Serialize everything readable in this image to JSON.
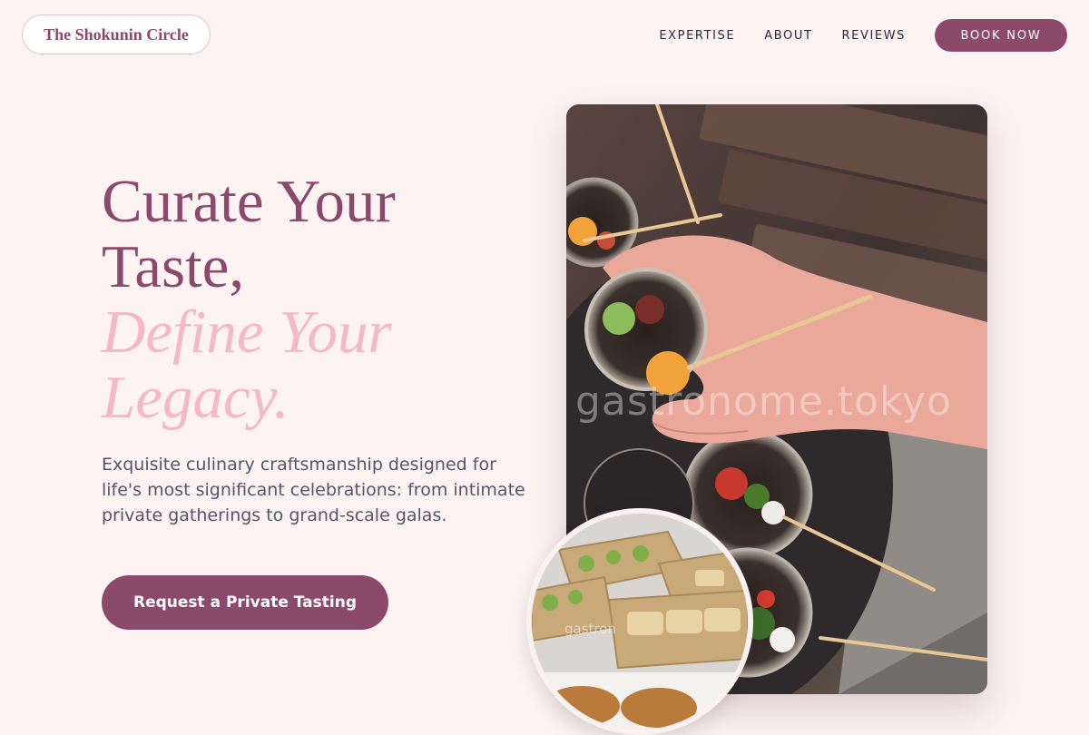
{
  "header": {
    "logo_text": "The Shokunin Circle",
    "nav": [
      "EXPERTISE",
      "ABOUT",
      "REVIEWS"
    ],
    "book_label": "BOOK NOW"
  },
  "hero": {
    "title_line1": "Curate Your",
    "title_line2": "Taste,",
    "title_accent1": "Define Your",
    "title_accent2": "Legacy.",
    "description": "Exquisite culinary craftsmanship designed for life's most significant celebrations: from intimate private gatherings to grand-scale galas.",
    "cta_label": "Request a Private Tasting"
  },
  "images": {
    "main_watermark": "gastronome.tokyo",
    "circle_watermark": "gastron"
  },
  "colors": {
    "brand": "#8b4a6b",
    "accent_pink": "#f5b8c8",
    "background": "#fdf3f3"
  }
}
